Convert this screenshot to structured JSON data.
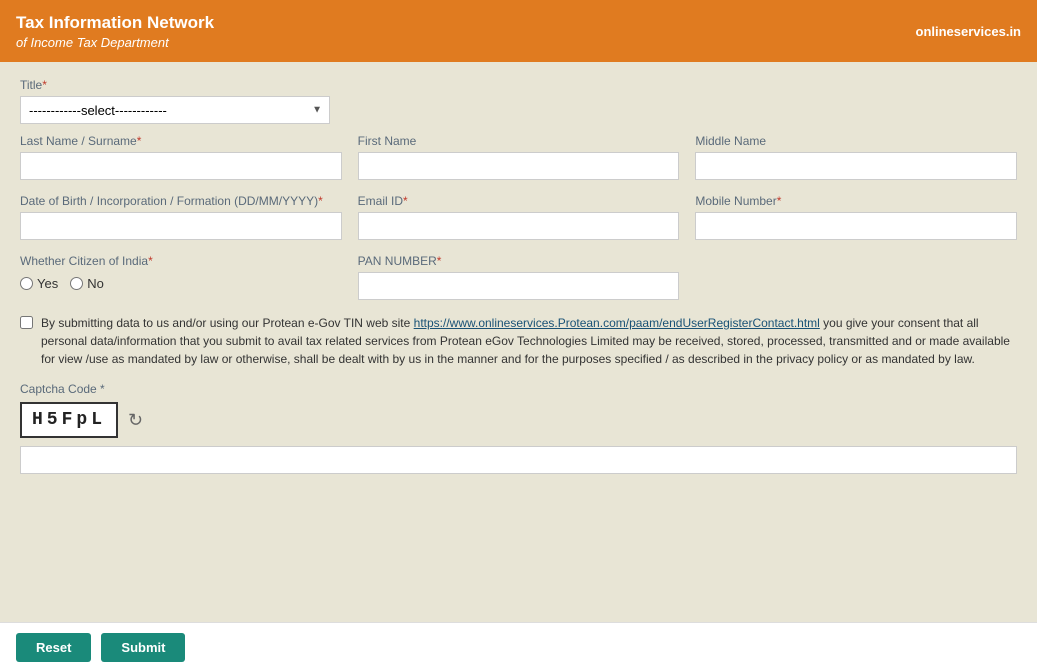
{
  "header": {
    "title_main": "Tax Information Network",
    "title_sub": "of Income Tax Department",
    "site_url": "onlineservices.in"
  },
  "form": {
    "title_label": "Title",
    "title_select_default": "------------select------------",
    "last_name_label": "Last Name / Surname",
    "first_name_label": "First Name",
    "middle_name_label": "Middle Name",
    "dob_label": "Date of Birth / Incorporation / Formation (DD/MM/YYYY)",
    "email_label": "Email ID",
    "mobile_label": "Mobile Number",
    "citizen_label": "Whether Citizen of India",
    "citizen_yes": "Yes",
    "citizen_no": "No",
    "pan_label": "PAN NUMBER",
    "consent_text_before": "By submitting data to us and/or using our Protean e-Gov TIN web site ",
    "consent_link_text": "https://www.onlineservices.Protean.com/paam/endUserRegisterContact.html",
    "consent_text_after": " you give your consent that all personal data/information that you submit to avail tax related services from Protean eGov Technologies Limited may be received, stored, processed, transmitted and or made available for view /use as mandated by law or otherwise, shall be dealt with by us in the manner and for the purposes specified / as described in the privacy policy or as mandated by law.",
    "captcha_label": "Captcha Code *",
    "captcha_code": "H5FpL",
    "reset_label": "Reset",
    "submit_label": "Submit"
  }
}
